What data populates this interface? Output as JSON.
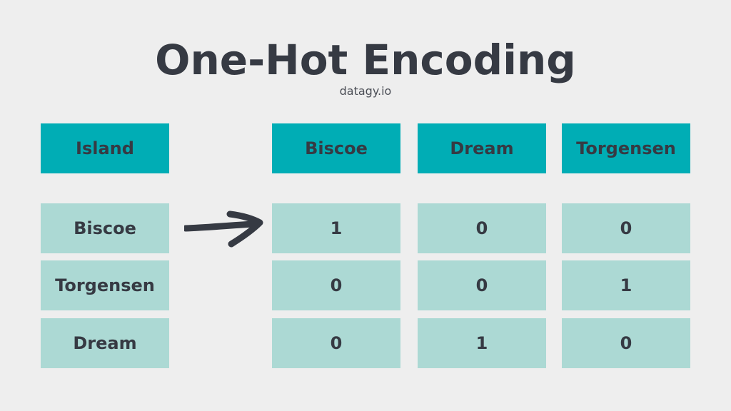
{
  "title": "One-Hot Encoding",
  "subtitle": "datagy.io",
  "colors": {
    "header": "#00adb5",
    "cell": "#acd9d4",
    "text": "#363a43",
    "background": "#eeeeee"
  },
  "source_table": {
    "header": "Island",
    "rows": [
      "Biscoe",
      "Torgensen",
      "Dream"
    ]
  },
  "encoded_table": {
    "headers": [
      "Biscoe",
      "Dream",
      "Torgensen"
    ],
    "rows": [
      [
        "1",
        "0",
        "0"
      ],
      [
        "0",
        "0",
        "1"
      ],
      [
        "0",
        "1",
        "0"
      ]
    ]
  },
  "arrow_icon": "right-arrow"
}
